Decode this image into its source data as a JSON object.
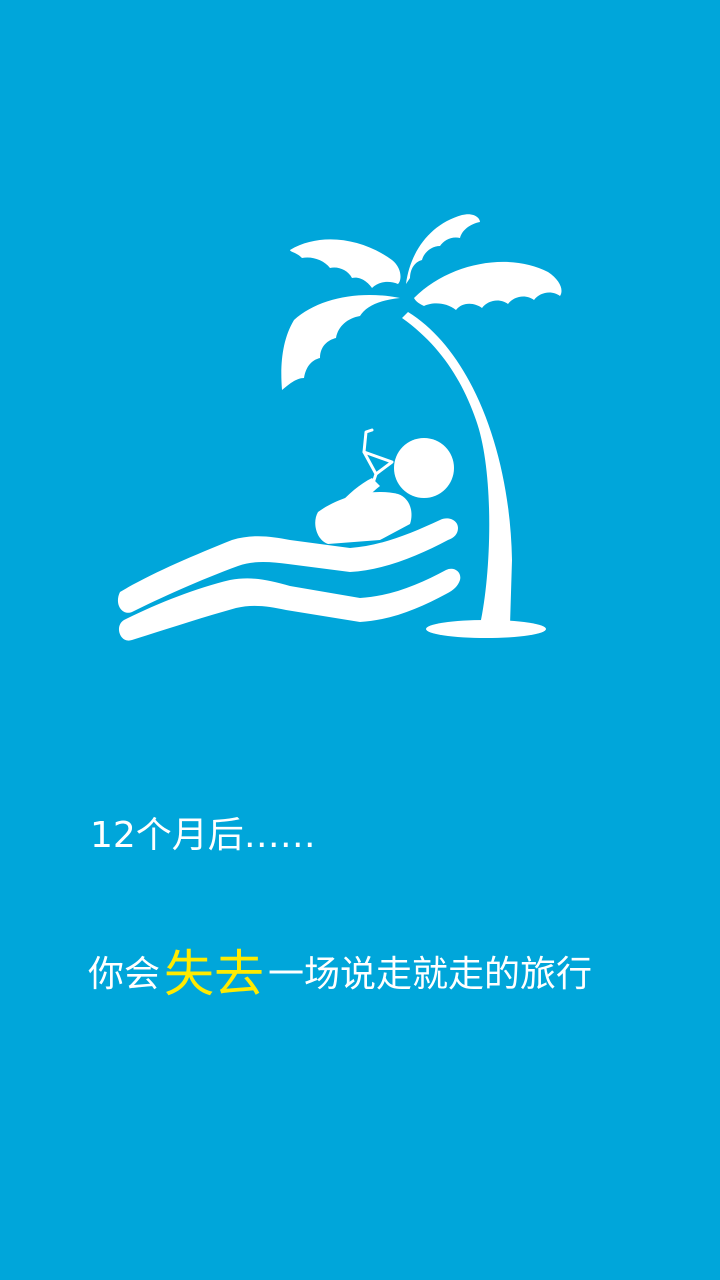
{
  "colors": {
    "background": "#00a6da",
    "text": "#ffffff",
    "highlight": "#ffeb00"
  },
  "illustration": {
    "icon": "beach-relax-icon"
  },
  "caption": {
    "line1": "12个月后……",
    "line2_prefix": "你会",
    "line2_highlight": "失去",
    "line2_suffix": "一场说走就走的旅行"
  }
}
